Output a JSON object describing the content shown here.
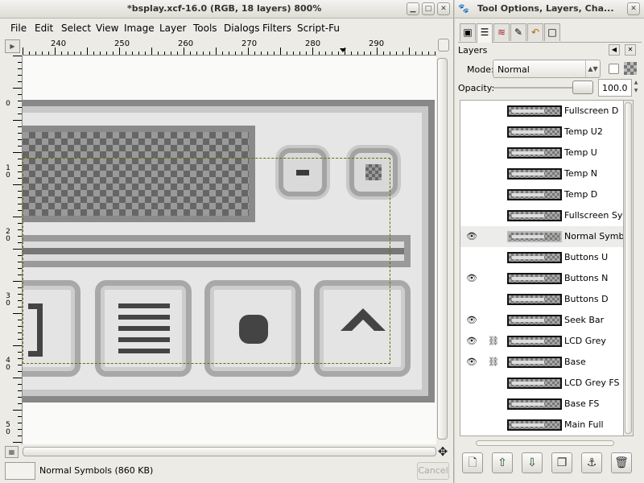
{
  "image_window": {
    "title": "*bsplay.xcf-16.0 (RGB, 18 layers) 800%",
    "wm_buttons": [
      "minimize-icon",
      "maximize-icon",
      "close-icon"
    ],
    "menu": [
      "File",
      "Edit",
      "Select",
      "View",
      "Image",
      "Layer",
      "Tools",
      "Dialogs",
      "Filters",
      "Script-Fu"
    ],
    "hruler_labels": [
      "240",
      "250",
      "260",
      "270",
      "280",
      "290"
    ],
    "vruler_labels": [
      "0",
      "1\n0",
      "2\n0",
      "3\n0",
      "4\n0",
      "5\n0"
    ],
    "status": {
      "text": "Normal Symbols (860 KB)",
      "cancel_label": "Cancel"
    }
  },
  "dock": {
    "title": "Tool Options, Layers, Cha...",
    "tabs": [
      "tool-options-icon",
      "layers-icon",
      "channels-icon",
      "paths-icon",
      "undo-icon",
      "image-icon"
    ],
    "panel_title": "Layers",
    "mode_label": "Mode:",
    "mode_value": "Normal",
    "opacity_label": "Opacity:",
    "opacity_value": "100.0",
    "opacity_percent": 100,
    "layers": [
      {
        "name": "Fullscreen D",
        "visible": false,
        "linked": false,
        "selected": false
      },
      {
        "name": "Temp U2",
        "visible": false,
        "linked": false,
        "selected": false
      },
      {
        "name": "Temp U",
        "visible": false,
        "linked": false,
        "selected": false
      },
      {
        "name": "Temp N",
        "visible": false,
        "linked": false,
        "selected": false
      },
      {
        "name": "Temp D",
        "visible": false,
        "linked": false,
        "selected": false
      },
      {
        "name": "Fullscreen Sym",
        "visible": false,
        "linked": false,
        "selected": false
      },
      {
        "name": "Normal Symbols",
        "visible": true,
        "linked": false,
        "selected": true
      },
      {
        "name": "Buttons U",
        "visible": false,
        "linked": false,
        "selected": false
      },
      {
        "name": "Buttons N",
        "visible": true,
        "linked": false,
        "selected": false
      },
      {
        "name": "Buttons D",
        "visible": false,
        "linked": false,
        "selected": false
      },
      {
        "name": "Seek Bar",
        "visible": true,
        "linked": false,
        "selected": false
      },
      {
        "name": "LCD Grey",
        "visible": true,
        "linked": true,
        "selected": false
      },
      {
        "name": "Base",
        "visible": true,
        "linked": true,
        "selected": false
      },
      {
        "name": "LCD Grey FS",
        "visible": false,
        "linked": false,
        "selected": false
      },
      {
        "name": "Base FS",
        "visible": false,
        "linked": false,
        "selected": false
      },
      {
        "name": "Main Full",
        "visible": false,
        "linked": false,
        "selected": false
      }
    ],
    "actions": [
      "new-layer-icon",
      "raise-layer-icon",
      "lower-layer-icon",
      "duplicate-layer-icon",
      "anchor-layer-icon",
      "delete-layer-icon"
    ]
  }
}
